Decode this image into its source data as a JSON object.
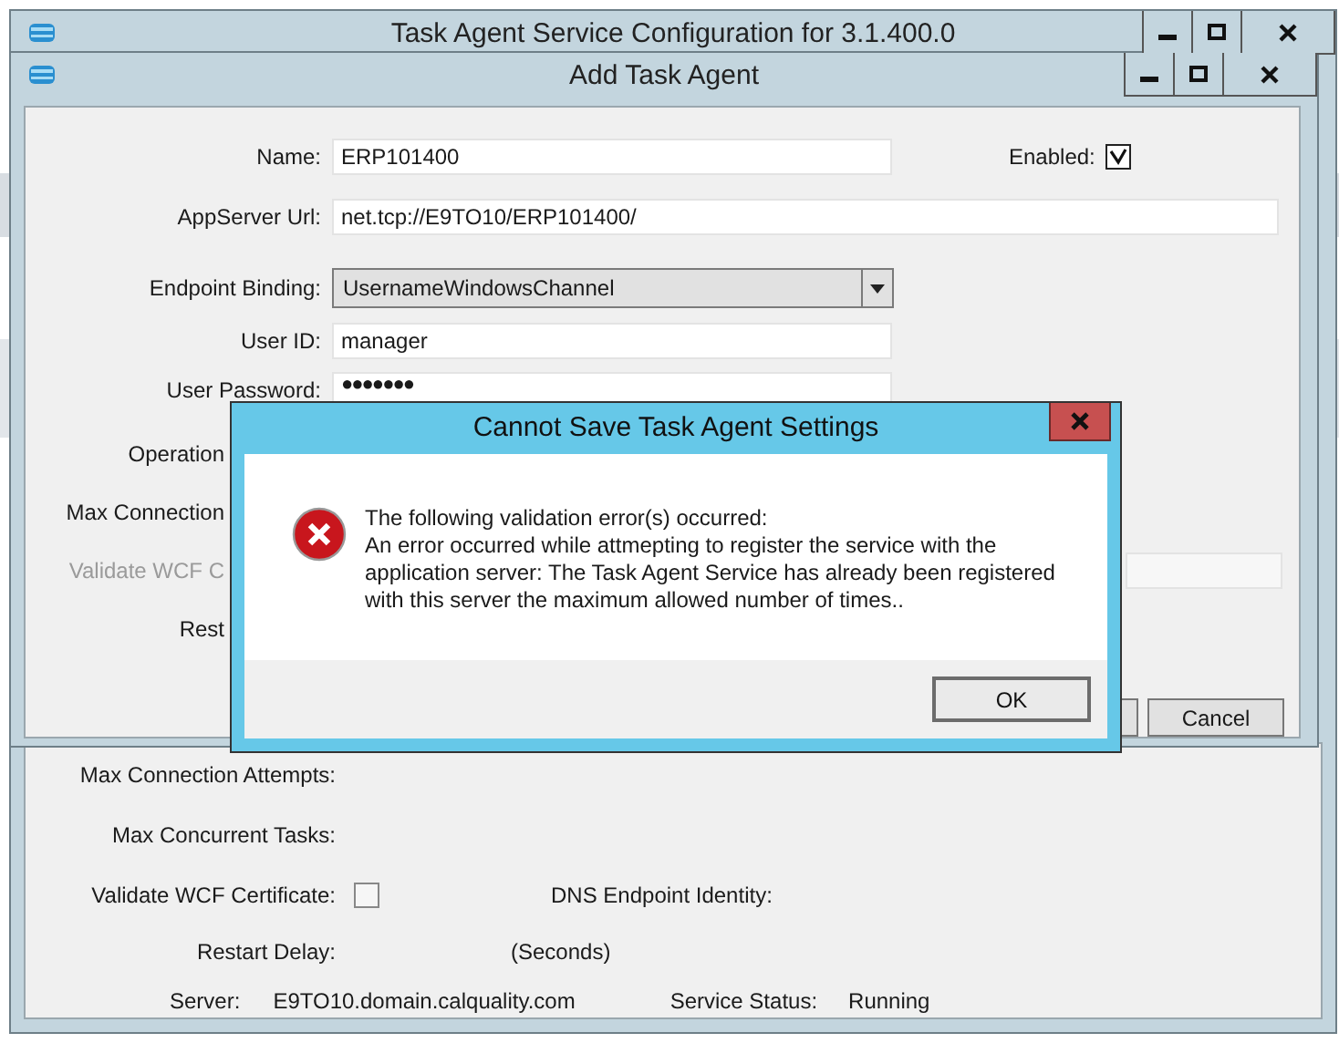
{
  "main_window": {
    "title": "Task Agent Service Configuration for 3.1.400.0",
    "fields": [
      {
        "label": "Max Connection Attempts:"
      },
      {
        "label": "Max Concurrent Tasks:"
      }
    ],
    "validate_wcf": {
      "label": "Validate WCF Certificate:",
      "checked": false
    },
    "dns_endpoint_label": "DNS Endpoint Identity:",
    "restart_delay": {
      "label": "Restart Delay:",
      "unit": "(Seconds)"
    },
    "status_bar": {
      "server_label": "Server:",
      "server": "E9TO10.domain.calquality.com",
      "status_label": "Service Status:",
      "status": "Running"
    }
  },
  "add_window": {
    "title": "Add Task Agent",
    "name": {
      "label": "Name:",
      "value": "ERP101400"
    },
    "enabled": {
      "label": "Enabled:",
      "checked": true
    },
    "appserver_url": {
      "label": "AppServer Url:",
      "value": "net.tcp://E9TO10/ERP101400/"
    },
    "endpoint_binding": {
      "label": "Endpoint Binding:",
      "value": "UsernameWindowsChannel"
    },
    "user_id": {
      "label": "User ID:",
      "value": "manager"
    },
    "user_password": {
      "label": "User Password:",
      "value": "●●●●●●●"
    },
    "covered_rows": [
      {
        "label": "Operation",
        "disabled": false,
        "field": false
      },
      {
        "label": "Max Connection",
        "disabled": false,
        "field": false
      },
      {
        "label": "Validate WCF C",
        "disabled": true,
        "field": true
      },
      {
        "label": "Rest",
        "disabled": false,
        "field": false
      }
    ],
    "buttons": [
      "Cancel"
    ]
  },
  "dialog": {
    "title": "Cannot Save Task Agent Settings",
    "message": [
      "The following validation error(s) occurred:",
      "An error occurred while attmepting to register the service with the application server: The Task Agent Service has already been registered with this server the maximum allowed number of times.."
    ],
    "button": "OK"
  }
}
